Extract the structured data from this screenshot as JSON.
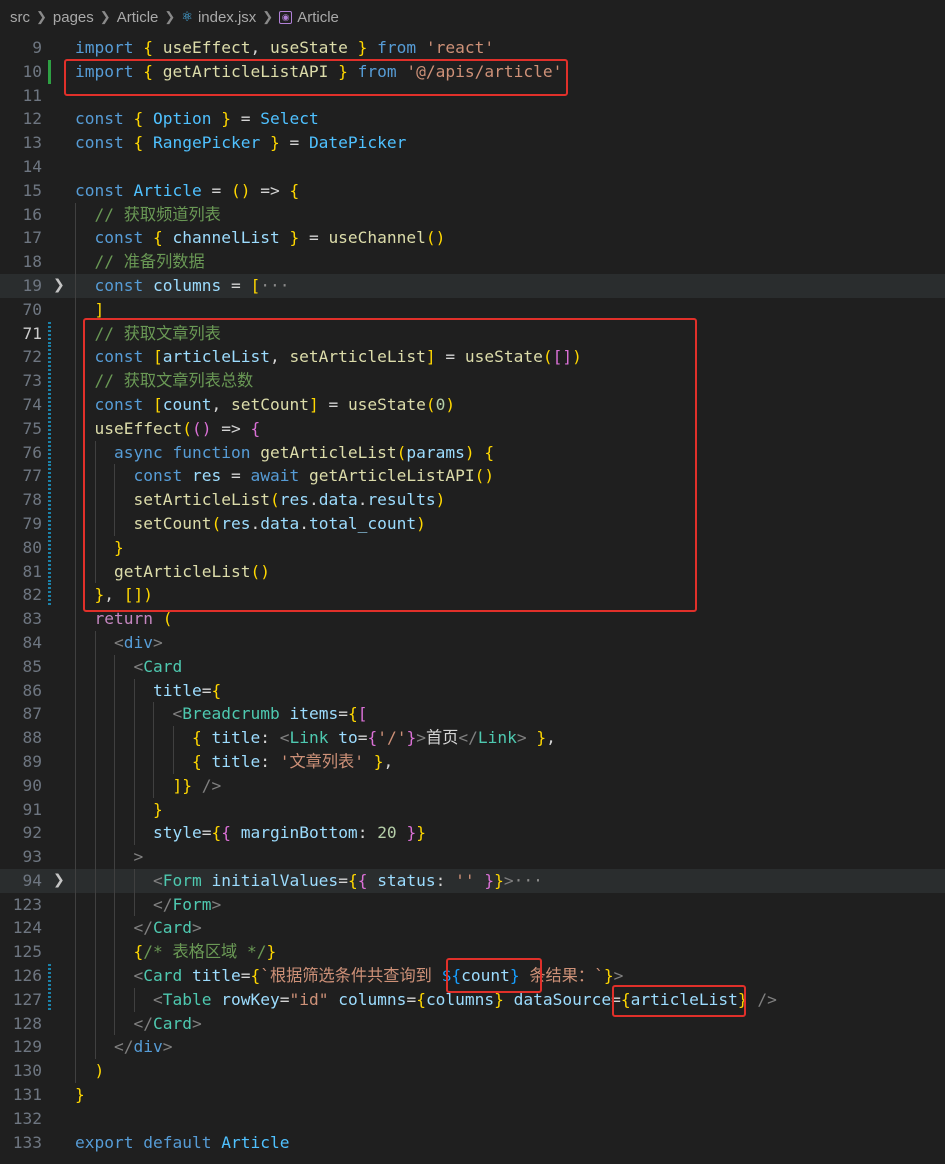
{
  "breadcrumb": {
    "items": [
      "src",
      "pages",
      "Article",
      "index.jsx",
      "Article"
    ]
  },
  "colors": {
    "highlight": "#e0302a",
    "added": "#2ea043",
    "modified": "#1b81a8"
  },
  "lines": [
    {
      "n": "9",
      "t": "import { useEffect, useState } from 'react'"
    },
    {
      "n": "10",
      "t": "import { getArticleListAPI } from '@/apis/article'"
    },
    {
      "n": "11",
      "t": ""
    },
    {
      "n": "12",
      "t": "const { Option } = Select"
    },
    {
      "n": "13",
      "t": "const { RangePicker } = DatePicker"
    },
    {
      "n": "14",
      "t": ""
    },
    {
      "n": "15",
      "t": "const Article = () => {"
    },
    {
      "n": "16",
      "t": "  // 获取频道列表"
    },
    {
      "n": "17",
      "t": "  const { channelList } = useChannel()"
    },
    {
      "n": "18",
      "t": "  // 准备列数据"
    },
    {
      "n": "19",
      "t": "  const columns = [···"
    },
    {
      "n": "70",
      "t": "  ]"
    },
    {
      "n": "71",
      "t": "  // 获取文章列表"
    },
    {
      "n": "72",
      "t": "  const [articleList, setArticleList] = useState([])"
    },
    {
      "n": "73",
      "t": "  // 获取文章列表总数"
    },
    {
      "n": "74",
      "t": "  const [count, setCount] = useState(0)"
    },
    {
      "n": "75",
      "t": "  useEffect(() => {"
    },
    {
      "n": "76",
      "t": "    async function getArticleList(params) {"
    },
    {
      "n": "77",
      "t": "      const res = await getArticleListAPI()"
    },
    {
      "n": "78",
      "t": "      setArticleList(res.data.results)"
    },
    {
      "n": "79",
      "t": "      setCount(res.data.total_count)"
    },
    {
      "n": "80",
      "t": "    }"
    },
    {
      "n": "81",
      "t": "    getArticleList()"
    },
    {
      "n": "82",
      "t": "  }, [])"
    },
    {
      "n": "83",
      "t": "  return ("
    },
    {
      "n": "84",
      "t": "    <div>"
    },
    {
      "n": "85",
      "t": "      <Card"
    },
    {
      "n": "86",
      "t": "        title={"
    },
    {
      "n": "87",
      "t": "          <Breadcrumb items={["
    },
    {
      "n": "88",
      "t": "            { title: <Link to={'/'}>首页</Link> },"
    },
    {
      "n": "89",
      "t": "            { title: '文章列表' },"
    },
    {
      "n": "90",
      "t": "          ]} />"
    },
    {
      "n": "91",
      "t": "        }"
    },
    {
      "n": "92",
      "t": "        style={{ marginBottom: 20 }}"
    },
    {
      "n": "93",
      "t": "      >"
    },
    {
      "n": "94",
      "t": "        <Form initialValues={{ status: '' }}>···"
    },
    {
      "n": "123",
      "t": "        </Form>"
    },
    {
      "n": "124",
      "t": "      </Card>"
    },
    {
      "n": "125",
      "t": "      {/* 表格区域 */}"
    },
    {
      "n": "126",
      "t": "      <Card title={`根据筛选条件共查询到 ${count} 条结果：`}>"
    },
    {
      "n": "127",
      "t": "        <Table rowKey=\"id\" columns={columns} dataSource={articleList} />"
    },
    {
      "n": "128",
      "t": "      </Card>"
    },
    {
      "n": "129",
      "t": "    </div>"
    },
    {
      "n": "130",
      "t": "  )"
    },
    {
      "n": "131",
      "t": "}"
    },
    {
      "n": "132",
      "t": ""
    },
    {
      "n": "133",
      "t": "export default Article"
    }
  ]
}
